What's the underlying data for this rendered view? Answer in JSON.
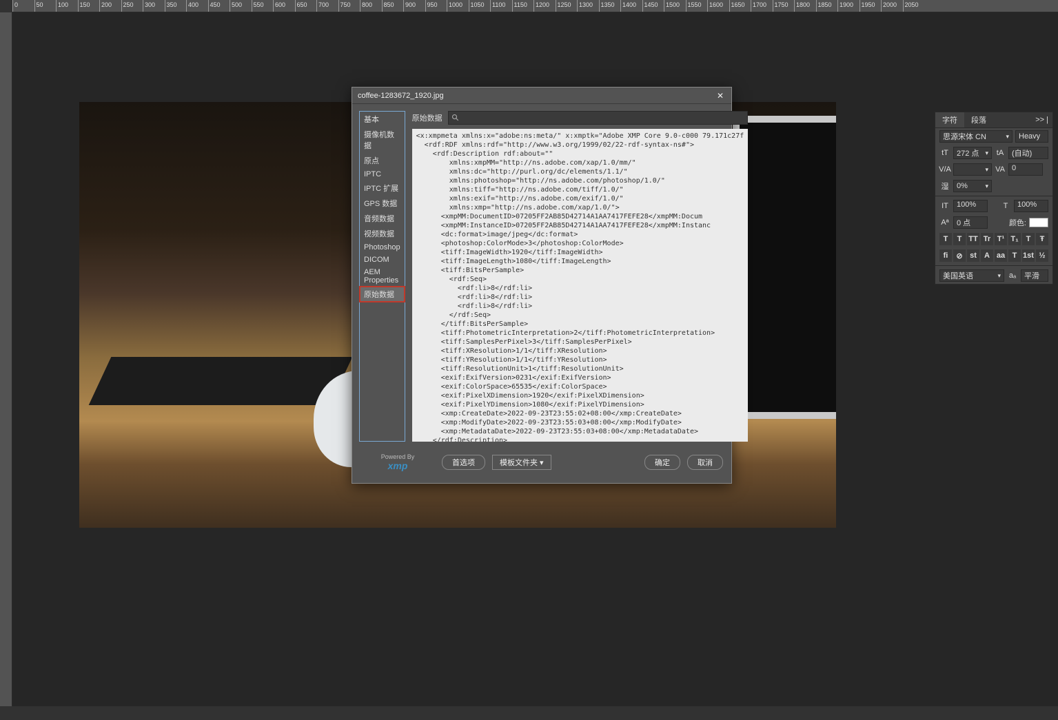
{
  "ruler_h": [
    0,
    50,
    100,
    150,
    200,
    250,
    300,
    350,
    400,
    450,
    500,
    550,
    600,
    650,
    700,
    750,
    800,
    850,
    900,
    950,
    1000,
    1050,
    1100,
    1150,
    1200,
    1250,
    1300,
    1350,
    1400,
    1450,
    1500,
    1550,
    1600,
    1650,
    1700,
    1750,
    1800,
    1850,
    1900,
    1950,
    2000,
    2050
  ],
  "dialog": {
    "title": "coffee-1283672_1920.jpg",
    "sidebar": {
      "items": [
        "基本",
        "摄像机数据",
        "原点",
        "IPTC",
        "IPTC 扩展",
        "GPS 数据",
        "音频数据",
        "视频数据",
        "Photoshop",
        "DICOM",
        "AEM Properties",
        "原始数据"
      ],
      "selected_index": 11
    },
    "content_label": "原始数据",
    "search_placeholder": "",
    "preferences": "首选项",
    "templates": "模板文件夹 ▾",
    "ok": "确定",
    "cancel": "取消",
    "powered_by": "Powered By",
    "xmp": "xmp",
    "raw_lines": [
      "<x:xmpmeta xmlns:x=\"adobe:ns:meta/\" x:xmptk=\"Adobe XMP Core 9.0-c000 79.171c27f",
      "  <rdf:RDF xmlns:rdf=\"http://www.w3.org/1999/02/22-rdf-syntax-ns#\">",
      "    <rdf:Description rdf:about=\"\"",
      "        xmlns:xmpMM=\"http://ns.adobe.com/xap/1.0/mm/\"",
      "        xmlns:dc=\"http://purl.org/dc/elements/1.1/\"",
      "        xmlns:photoshop=\"http://ns.adobe.com/photoshop/1.0/\"",
      "        xmlns:tiff=\"http://ns.adobe.com/tiff/1.0/\"",
      "        xmlns:exif=\"http://ns.adobe.com/exif/1.0/\"",
      "        xmlns:xmp=\"http://ns.adobe.com/xap/1.0/\">",
      "      <xmpMM:DocumentID>07205FF2AB85D42714A1AA7417FEFE28</xmpMM:Docum",
      "      <xmpMM:InstanceID>07205FF2AB85D42714A1AA7417FEFE28</xmpMM:Instanc",
      "      <dc:format>image/jpeg</dc:format>",
      "      <photoshop:ColorMode>3</photoshop:ColorMode>",
      "      <tiff:ImageWidth>1920</tiff:ImageWidth>",
      "      <tiff:ImageLength>1080</tiff:ImageLength>",
      "      <tiff:BitsPerSample>",
      "        <rdf:Seq>",
      "          <rdf:li>8</rdf:li>",
      "          <rdf:li>8</rdf:li>",
      "          <rdf:li>8</rdf:li>",
      "        </rdf:Seq>",
      "      </tiff:BitsPerSample>",
      "      <tiff:PhotometricInterpretation>2</tiff:PhotometricInterpretation>",
      "      <tiff:SamplesPerPixel>3</tiff:SamplesPerPixel>",
      "      <tiff:XResolution>1/1</tiff:XResolution>",
      "      <tiff:YResolution>1/1</tiff:YResolution>",
      "      <tiff:ResolutionUnit>1</tiff:ResolutionUnit>",
      "      <exif:ExifVersion>0231</exif:ExifVersion>",
      "      <exif:ColorSpace>65535</exif:ColorSpace>",
      "      <exif:PixelXDimension>1920</exif:PixelXDimension>",
      "      <exif:PixelYDimension>1080</exif:PixelYDimension>",
      "      <xmp:CreateDate>2022-09-23T23:55:02+08:00</xmp:CreateDate>",
      "      <xmp:ModifyDate>2022-09-23T23:55:03+08:00</xmp:ModifyDate>",
      "      <xmp:MetadataDate>2022-09-23T23:55:03+08:00</xmp:MetadataDate>",
      "    </rdf:Description>"
    ]
  },
  "char_panel": {
    "tab1": "字符",
    "tab2": "段落",
    "expand": ">> |",
    "font": "思源宋体 CN",
    "weight": "Heavy",
    "size": "272 点",
    "leading": "(自动)",
    "kerning": "",
    "tracking": "0",
    "vscale_label": "IT",
    "vscale": "100%",
    "hscale_label": "T",
    "hscale": "100%",
    "tsume_label": "湿",
    "tsume": "0%",
    "baseline": "0 点",
    "color_label": "颜色:",
    "lang": "美国英语",
    "aa": "平滑",
    "style_buttons": [
      "T",
      "T",
      "TT",
      "Tr",
      "T¹",
      "T₁",
      "T",
      "Ŧ"
    ],
    "ot_buttons": [
      "fi",
      "⊘",
      "st",
      "A",
      "aa",
      "T",
      "1st",
      "½"
    ]
  }
}
